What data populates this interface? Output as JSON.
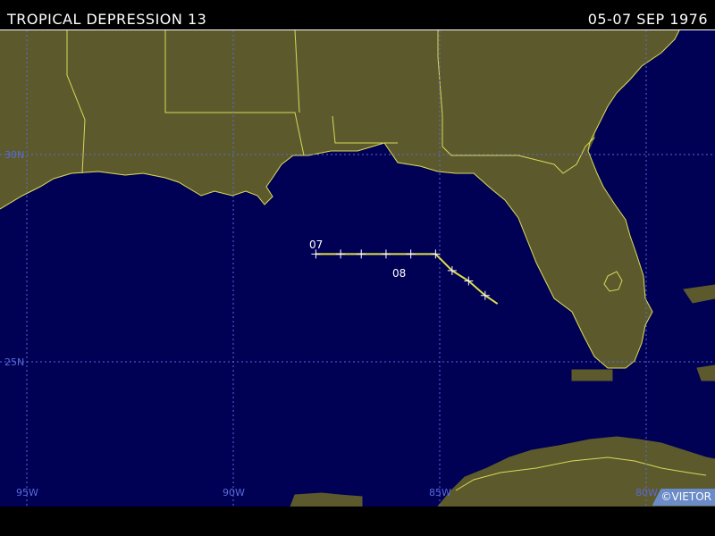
{
  "header": {
    "title": "TROPICAL DEPRESSION 13",
    "dates": "05-07 SEP 1976"
  },
  "map": {
    "colors": {
      "ocean": "#000055",
      "land": "#5c5a2c",
      "coastline": "#d8d85a",
      "grid": "#5a6ad8",
      "track": "#e0e04a",
      "labels": "#ffffff"
    },
    "lat_labels": [
      "30N",
      "25N"
    ],
    "lon_labels": [
      "95W",
      "90W",
      "85W",
      "80W"
    ],
    "track": {
      "day_labels": [
        "07",
        "08"
      ],
      "points": [
        {
          "lat": 27.6,
          "lon": 88.0
        },
        {
          "lat": 27.6,
          "lon": 87.4
        },
        {
          "lat": 27.6,
          "lon": 86.9
        },
        {
          "lat": 27.6,
          "lon": 86.3
        },
        {
          "lat": 27.6,
          "lon": 85.7
        },
        {
          "lat": 27.6,
          "lon": 85.1
        },
        {
          "lat": 27.2,
          "lon": 84.7
        },
        {
          "lat": 26.95,
          "lon": 84.3
        },
        {
          "lat": 26.6,
          "lon": 83.9
        },
        {
          "lat": 26.4,
          "lon": 83.6
        }
      ]
    }
  },
  "footer": {
    "copyright": "©VIETOR"
  }
}
